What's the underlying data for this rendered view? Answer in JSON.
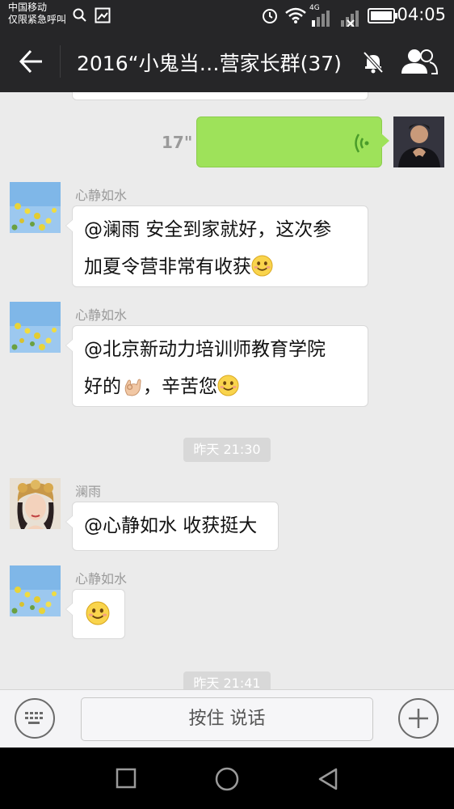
{
  "status_bar": {
    "carrier_line1": "中国移动",
    "carrier_line2": "仅限紧急呼叫",
    "network": "4G",
    "time": "04:05"
  },
  "title_bar": {
    "title": "2016“小鬼当…营家长群(37)",
    "icons": [
      "back-arrow-icon",
      "mute-bell-icon",
      "group-members-icon"
    ]
  },
  "messages": {
    "voice": {
      "duration": "17\""
    },
    "msg1": {
      "sender": "心静如水",
      "line1": "@澜雨 安全到家就好，这次参",
      "line2": "加夏令营非常有收获"
    },
    "msg2": {
      "sender": "心静如水",
      "line1": "@北京新动力培训师教育学院",
      "line2_a": "好的",
      "line2_b": "，辛苦您"
    },
    "timestamp1": "昨天 21:30",
    "msg3": {
      "sender": "澜雨",
      "text": "@心静如水 收获挺大"
    },
    "msg4": {
      "sender": "心静如水"
    },
    "timestamp2": "昨天 21:41"
  },
  "input_bar": {
    "talk_label": "按住 说话"
  },
  "colors": {
    "bar_dark": "#262628",
    "chat_bg": "#ebebeb",
    "voice_bubble": "#9ee25a"
  }
}
